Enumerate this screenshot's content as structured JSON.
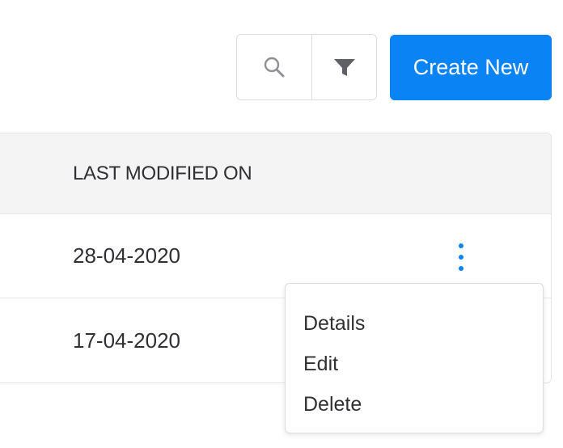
{
  "toolbar": {
    "search_icon": "search-icon",
    "filter_icon": "filter-icon",
    "create_label": "Create New",
    "accent_color": "#0a84f5"
  },
  "table": {
    "columns": [
      "LAST MODIFIED ON"
    ],
    "rows": [
      {
        "last_modified_on": "28-04-2020"
      },
      {
        "last_modified_on": "17-04-2020"
      }
    ]
  },
  "row_menu": {
    "icon": "more-vertical-icon",
    "items": [
      "Details",
      "Edit",
      "Delete"
    ]
  }
}
